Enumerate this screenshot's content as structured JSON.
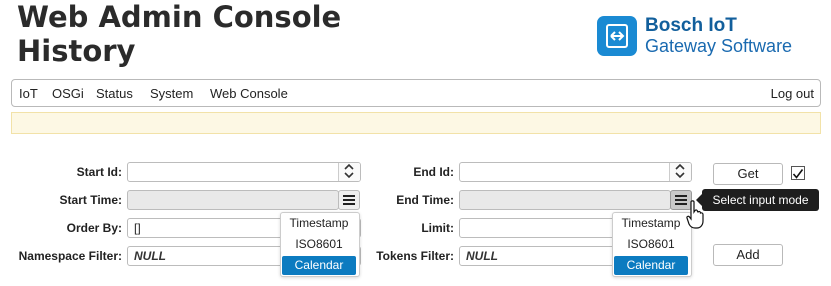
{
  "header": {
    "title_line1": "Web Admin Console",
    "title_line2": "History",
    "logo_line1": "Bosch IoT",
    "logo_line2": "Gateway Software"
  },
  "nav": {
    "items": [
      "IoT",
      "OSGi",
      "Status",
      "System",
      "Web Console"
    ],
    "logout": "Log out"
  },
  "form": {
    "start_id": {
      "label": "Start Id:",
      "value": ""
    },
    "start_time": {
      "label": "Start Time:",
      "value": ""
    },
    "order_by": {
      "label": "Order By:",
      "value": "[]"
    },
    "namespace_filter": {
      "label": "Namespace Filter:",
      "value": "NULL"
    },
    "end_id": {
      "label": "End Id:",
      "value": ""
    },
    "end_time": {
      "label": "End Time:",
      "value": ""
    },
    "limit": {
      "label": "Limit:",
      "value": ""
    },
    "tokens_filter": {
      "label": "Tokens Filter:",
      "value": "NULL"
    },
    "get_button": "Get",
    "add_button": "Add",
    "get_checkbox_checked": true
  },
  "input_mode_menu": {
    "options": [
      "Timestamp",
      "ISO8601",
      "Calendar"
    ],
    "selected": "Calendar"
  },
  "tooltip": "Select input mode",
  "colors": {
    "logo_blue": "#1a8ad3",
    "logo_text": "#125f9c",
    "selected_option": "#0c7bc0",
    "notice_bg": "#fdf8e4"
  },
  "icons": [
    "logo-icon",
    "spinner-arrows-icon",
    "hamburger-menu-icon",
    "check-icon",
    "hand-pointer-cursor-icon"
  ]
}
